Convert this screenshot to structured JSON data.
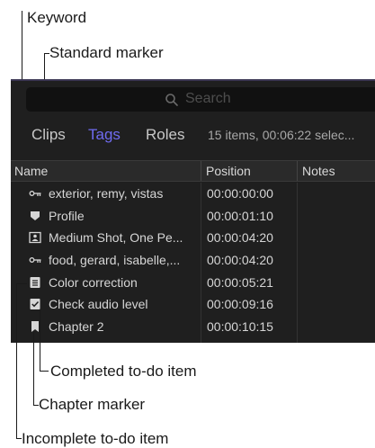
{
  "callouts": {
    "keyword": "Keyword",
    "standard_marker": "Standard marker",
    "completed_todo": "Completed to-do item",
    "chapter_marker": "Chapter marker",
    "incomplete_todo": "Incomplete to-do item"
  },
  "search": {
    "placeholder": "Search"
  },
  "tabs": [
    {
      "label": "Clips",
      "active": false
    },
    {
      "label": "Tags",
      "active": true
    },
    {
      "label": "Roles",
      "active": false
    }
  ],
  "status": "15 items, 00:06:22 selec...",
  "columns": {
    "name": "Name",
    "position": "Position",
    "notes": "Notes"
  },
  "rows": [
    {
      "icon": "keyword-icon",
      "name": "exterior, remy, vistas",
      "position": "00:00:00:00"
    },
    {
      "icon": "standard-marker-icon",
      "name": "Profile",
      "position": "00:00:01:10"
    },
    {
      "icon": "analysis-keyword-icon",
      "name": "Medium Shot, One Pe...",
      "position": "00:00:04:20"
    },
    {
      "icon": "keyword-icon",
      "name": "food, gerard, isabelle,...",
      "position": "00:00:04:20"
    },
    {
      "icon": "incomplete-todo-icon",
      "name": "Color correction",
      "position": "00:00:05:21"
    },
    {
      "icon": "completed-todo-icon",
      "name": "Check audio level",
      "position": "00:00:09:16"
    },
    {
      "icon": "chapter-marker-icon",
      "name": "Chapter 2",
      "position": "00:00:10:15"
    }
  ],
  "colors": {
    "accent": "#6f6bf0",
    "panel": "#1f1f1f",
    "header": "#2a2a2a"
  }
}
